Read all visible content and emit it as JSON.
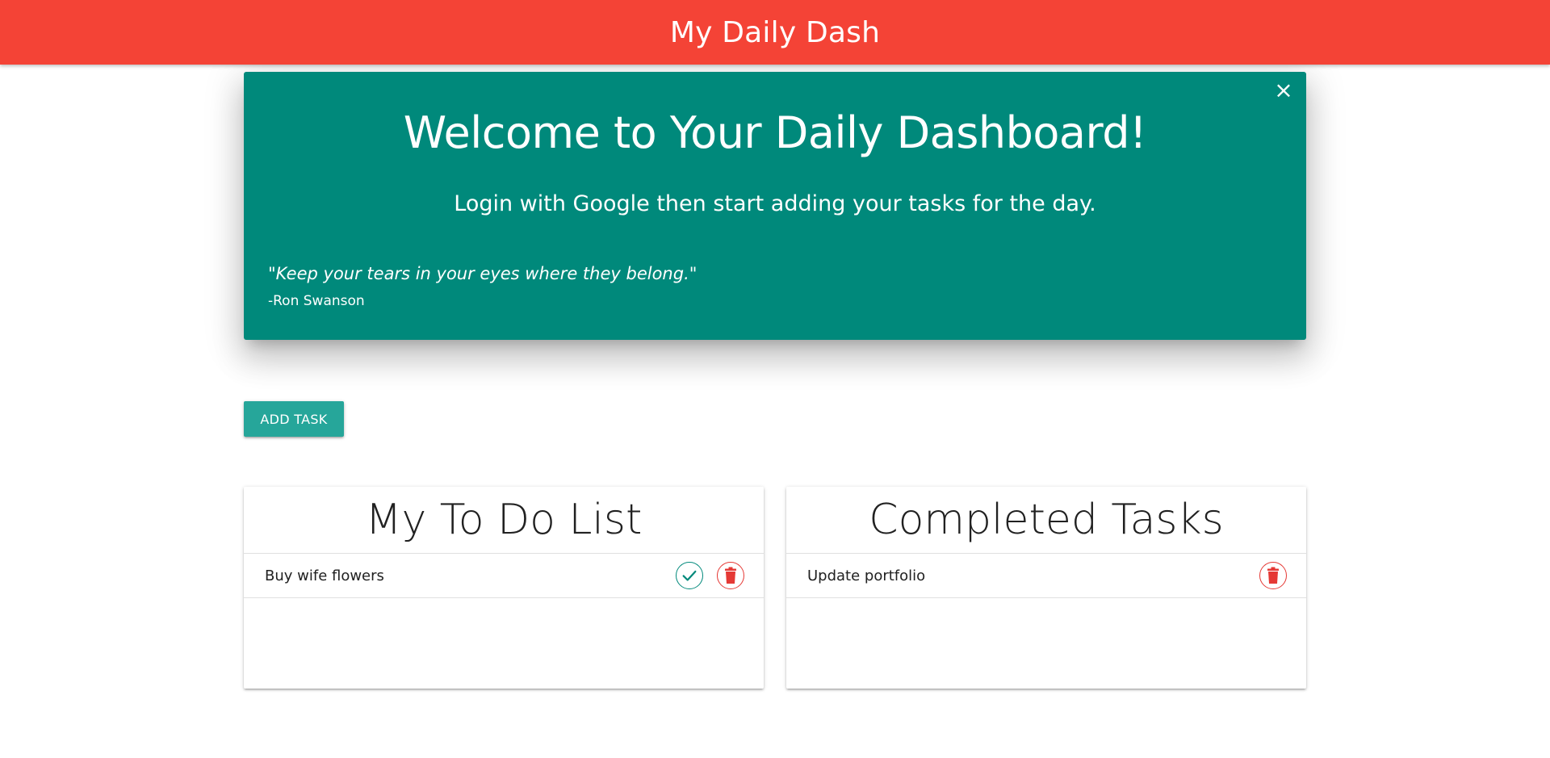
{
  "navbar": {
    "brand": "My Daily Dash"
  },
  "welcome": {
    "title": "Welcome to Your Daily Dashboard!",
    "subtitle": "Login with Google then start adding your tasks for the day.",
    "quote": "\"Keep your tears in your eyes where they belong.\"",
    "author": "-Ron Swanson",
    "close_label": "×"
  },
  "add_task": {
    "label": "ADD TASK"
  },
  "todo": {
    "title": "My To Do List",
    "items": [
      {
        "text": "Buy wife flowers"
      }
    ]
  },
  "completed": {
    "title": "Completed Tasks",
    "items": [
      {
        "text": "Update portfolio"
      }
    ]
  },
  "colors": {
    "navbar": "#f44336",
    "welcome_bg": "#00897b",
    "button": "#26a69a",
    "check": "#00897b",
    "delete": "#e53935"
  },
  "icons": {
    "check": "check-circle-icon",
    "delete": "trash-icon",
    "close": "close-icon"
  }
}
